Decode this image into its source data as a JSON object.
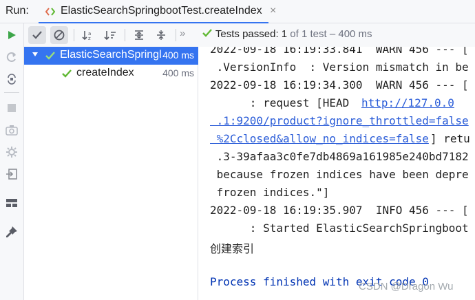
{
  "run_bar": {
    "label": "Run:",
    "tab_title": "ElasticSearchSpringbootTest.createIndex",
    "tab_close": "×"
  },
  "left_toolbar": {
    "icons": [
      "rerun-icon",
      "rerun-failed-icon",
      "toggle-auto-test-icon",
      "stop-icon",
      "screenshot-icon",
      "debug-settings-icon",
      "import-tests-icon",
      "layout-icon",
      "pin-icon"
    ]
  },
  "test_toolbar": {
    "status_passed": "Tests passed:",
    "status_count": "1",
    "status_rest": " of 1 test – 400 ms"
  },
  "tree": {
    "rows": [
      {
        "name": "ElasticSearchSpringl",
        "time": "400 ms",
        "selected": true
      },
      {
        "name": "createIndex",
        "time": "400 ms",
        "selected": false
      }
    ]
  },
  "console": {
    "lines": [
      "2022-09-18 16:19:33.841  WARN 456 --- [",
      " .VersionInfo  : Version mismatch in be",
      "2022-09-18 16:19:34.300  WARN 456 --- [",
      "      : request [HEAD ",
      "http://127.0.0",
      " .1:9200/product?ignore_throttled=false",
      " %2Cclosed&allow_no_indices=false",
      "] retu",
      " .3-39afaa3c0fe7db4869a161985e240bd7182",
      " because frozen indices have been depre",
      " frozen indices.\"]",
      "2022-09-18 16:19:35.907  INFO 456 --- [",
      "      : Started ElasticSearchSpringboot",
      "创建索引",
      "Process finished with exit code 0"
    ],
    "watermark": "CSDN @Dragon   Wu"
  },
  "colors": {
    "accent": "#3574f0",
    "pass_green": "#5fb832",
    "link": "#2a5cd8",
    "process": "#0033b3"
  }
}
